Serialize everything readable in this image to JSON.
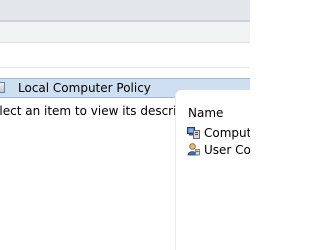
{
  "navigation_tree": {
    "selected_item": {
      "label": "Local Computer Policy",
      "icon": "policy-icon"
    }
  },
  "description_pane": {
    "text": "elect an item to view its description."
  },
  "content_pane": {
    "column_header": "Name",
    "items": [
      {
        "label": "Compute",
        "icon": "computer-configuration-icon"
      },
      {
        "label": "User Conf",
        "icon": "user-configuration-icon"
      }
    ]
  },
  "colors": {
    "selection_background": "#cfdff2",
    "selection_border": "#9fb9da"
  }
}
